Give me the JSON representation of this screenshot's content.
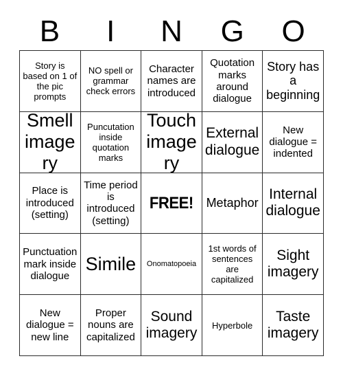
{
  "card": {
    "title": "BINGO",
    "header_letters": [
      "B",
      "I",
      "N",
      "G",
      "O"
    ],
    "rows": 5,
    "columns": 5,
    "border_color": "#2b2b2b",
    "background_color": "#ffffff",
    "text_color": "#000000",
    "cells": [
      [
        {
          "text": "Story is based on 1 of the pic prompts",
          "size": "sm",
          "free": false
        },
        {
          "text": "NO spell or grammar check errors",
          "size": "sm",
          "free": false
        },
        {
          "text": "Character names are introduced",
          "size": "md",
          "free": false
        },
        {
          "text": "Quotation marks around dialogue",
          "size": "md",
          "free": false
        },
        {
          "text": "Story has a beginning",
          "size": "lg",
          "free": false
        }
      ],
      [
        {
          "text": "Smell imagery",
          "size": "xxl",
          "free": false
        },
        {
          "text": "Puncutation inside quotation marks",
          "size": "sm",
          "free": false
        },
        {
          "text": "Touch imagery",
          "size": "xxl",
          "free": false
        },
        {
          "text": "External dialogue",
          "size": "xl",
          "free": false
        },
        {
          "text": "New dialogue = indented",
          "size": "md",
          "free": false
        }
      ],
      [
        {
          "text": "Place is introduced (setting)",
          "size": "md",
          "free": false
        },
        {
          "text": "Time period is introduced (setting)",
          "size": "md",
          "free": false
        },
        {
          "text": "FREE!",
          "size": "free",
          "free": true
        },
        {
          "text": "Metaphor",
          "size": "lg",
          "free": false
        },
        {
          "text": "Internal dialogue",
          "size": "xl",
          "free": false
        }
      ],
      [
        {
          "text": "Punctuation mark inside dialogue",
          "size": "md",
          "free": false
        },
        {
          "text": "Simile",
          "size": "xxl",
          "free": false
        },
        {
          "text": "Onomatopoeia",
          "size": "xs",
          "free": false
        },
        {
          "text": "1st words of sentences are capitalized",
          "size": "sm",
          "free": false
        },
        {
          "text": "Sight imagery",
          "size": "xl",
          "free": false
        }
      ],
      [
        {
          "text": "New dialogue = new line",
          "size": "md",
          "free": false
        },
        {
          "text": "Proper nouns are capitalized",
          "size": "md",
          "free": false
        },
        {
          "text": "Sound imagery",
          "size": "xl",
          "free": false
        },
        {
          "text": "Hyperbole",
          "size": "sm",
          "free": false
        },
        {
          "text": "Taste imagery",
          "size": "xl",
          "free": false
        }
      ]
    ]
  }
}
